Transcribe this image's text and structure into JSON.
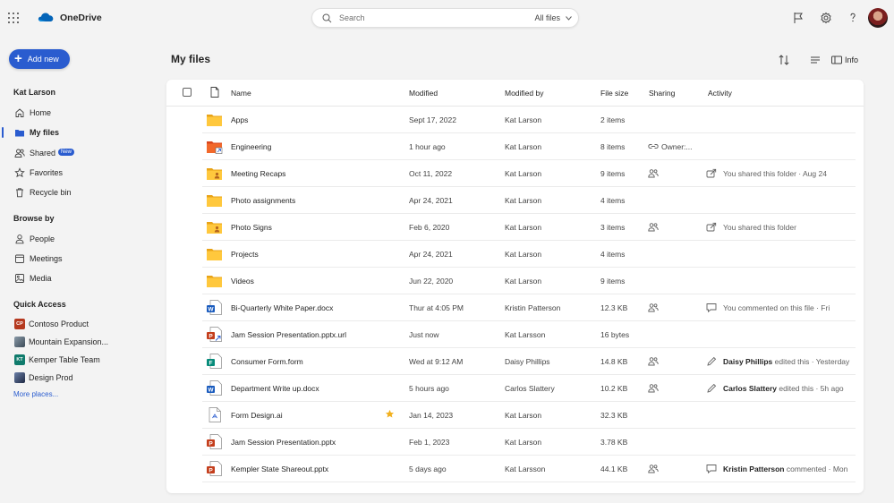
{
  "app": {
    "title": "OneDrive",
    "brand_color": "#0364b8"
  },
  "search": {
    "placeholder": "Search",
    "scope": "All files"
  },
  "topbar_icons": [
    "flag-icon",
    "gear-icon",
    "help-icon"
  ],
  "sidebar": {
    "add_new": "Add new",
    "user": "Kat Larson",
    "nav": [
      {
        "label": "Home",
        "icon": "home-icon"
      },
      {
        "label": "My files",
        "icon": "folder-icon",
        "active": true
      },
      {
        "label": "Shared",
        "icon": "people-icon",
        "badge": "New"
      },
      {
        "label": "Favorites",
        "icon": "star-icon"
      },
      {
        "label": "Recycle bin",
        "icon": "trash-icon"
      }
    ],
    "browse_by": "Browse by",
    "browse": [
      {
        "label": "People",
        "icon": "person-icon"
      },
      {
        "label": "Meetings",
        "icon": "calendar-icon"
      },
      {
        "label": "Media",
        "icon": "image-icon"
      }
    ],
    "quick_access": "Quick Access",
    "qa": [
      {
        "label": "Contoso Product",
        "abbr": "CP",
        "color": "#b5391f"
      },
      {
        "label": "Mountain Expansion...",
        "abbr": "",
        "color": "#5a6b7b"
      },
      {
        "label": "Kemper Table Team",
        "abbr": "KT",
        "color": "#0f7b6c"
      },
      {
        "label": "Design Prod",
        "abbr": "",
        "color": "#3b4a6b"
      }
    ],
    "more_places": "More places..."
  },
  "main": {
    "title": "My files",
    "info": "Info",
    "columns": {
      "name": "Name",
      "modified": "Modified",
      "modified_by": "Modified by",
      "size": "File size",
      "sharing": "Sharing",
      "activity": "Activity"
    },
    "rows": [
      {
        "name": "Apps",
        "icon": "folder",
        "modified": "Sept 17, 2022",
        "by": "Kat Larson",
        "size": "2 items",
        "sharing": "",
        "activity_icon": "",
        "activity_bold": "",
        "activity": ""
      },
      {
        "name": "Engineering",
        "icon": "folder-link",
        "modified": "1 hour ago",
        "by": "Kat Larson",
        "size": "8 items",
        "sharing": "link",
        "sharing_text": "Owner:...",
        "activity_icon": "",
        "activity_bold": "",
        "activity": ""
      },
      {
        "name": "Meeting Recaps",
        "icon": "folder-shared",
        "modified": "Oct 11, 2022",
        "by": "Kat Larson",
        "size": "9 items",
        "sharing": "people",
        "activity_icon": "share",
        "activity_bold": "",
        "activity": "You shared this folder · Aug 24"
      },
      {
        "name": "Photo assignments",
        "icon": "folder",
        "modified": "Apr 24, 2021",
        "by": "Kat Larson",
        "size": "4 items",
        "sharing": "",
        "activity_icon": "",
        "activity_bold": "",
        "activity": ""
      },
      {
        "name": "Photo Signs",
        "icon": "folder-shared",
        "modified": "Feb 6, 2020",
        "by": "Kat Larson",
        "size": "3 items",
        "sharing": "people",
        "activity_icon": "share",
        "activity_bold": "",
        "activity": "You shared this folder"
      },
      {
        "name": "Projects",
        "icon": "folder",
        "modified": "Apr 24, 2021",
        "by": "Kat Larson",
        "size": "4 items",
        "sharing": "",
        "activity_icon": "",
        "activity_bold": "",
        "activity": ""
      },
      {
        "name": "Videos",
        "icon": "folder",
        "modified": "Jun 22, 2020",
        "by": "Kat Larson",
        "size": "9 items",
        "sharing": "",
        "activity_icon": "",
        "activity_bold": "",
        "activity": ""
      },
      {
        "name": "Bi-Quarterly White Paper.docx",
        "icon": "word",
        "modified": "Thur at 4:05 PM",
        "by": "Kristin Patterson",
        "size": "12.3 KB",
        "sharing": "people",
        "activity_icon": "comment",
        "activity_bold": "",
        "activity": "You commented on this file · Fri"
      },
      {
        "name": "Jam Session Presentation.pptx.url",
        "icon": "ppt-link",
        "modified": "Just now",
        "by": "Kat Larsson",
        "size": "16 bytes",
        "sharing": "",
        "activity_icon": "",
        "activity_bold": "",
        "activity": ""
      },
      {
        "name": "Consumer Form.form",
        "icon": "forms",
        "modified": "Wed at 9:12 AM",
        "by": "Daisy Phillips",
        "size": "14.8 KB",
        "sharing": "people",
        "activity_icon": "edit",
        "activity_bold": "Daisy Phillips",
        "activity": " edited this · Yesterday"
      },
      {
        "name": "Department Write up.docx",
        "icon": "word",
        "modified": "5 hours ago",
        "by": "Carlos Slattery",
        "size": "10.2 KB",
        "sharing": "people",
        "activity_icon": "edit",
        "activity_bold": "Carlos Slattery",
        "activity": " edited this · 5h ago"
      },
      {
        "name": "Form Design.ai",
        "icon": "ai",
        "favorite": true,
        "modified": "Jan 14, 2023",
        "by": "Kat Larson",
        "size": "32.3 KB",
        "sharing": "",
        "activity_icon": "",
        "activity_bold": "",
        "activity": ""
      },
      {
        "name": "Jam Session Presentation.pptx",
        "icon": "ppt",
        "modified": "Feb 1, 2023",
        "by": "Kat Larson",
        "size": "3.78 KB",
        "sharing": "",
        "activity_icon": "",
        "activity_bold": "",
        "activity": ""
      },
      {
        "name": "Kempler State Shareout.pptx",
        "icon": "ppt",
        "modified": "5 days ago",
        "by": "Kat Larsson",
        "size": "44.1 KB",
        "sharing": "people",
        "activity_icon": "comment",
        "activity_bold": "Kristin Patterson",
        "activity": " commented · Mon"
      }
    ]
  }
}
